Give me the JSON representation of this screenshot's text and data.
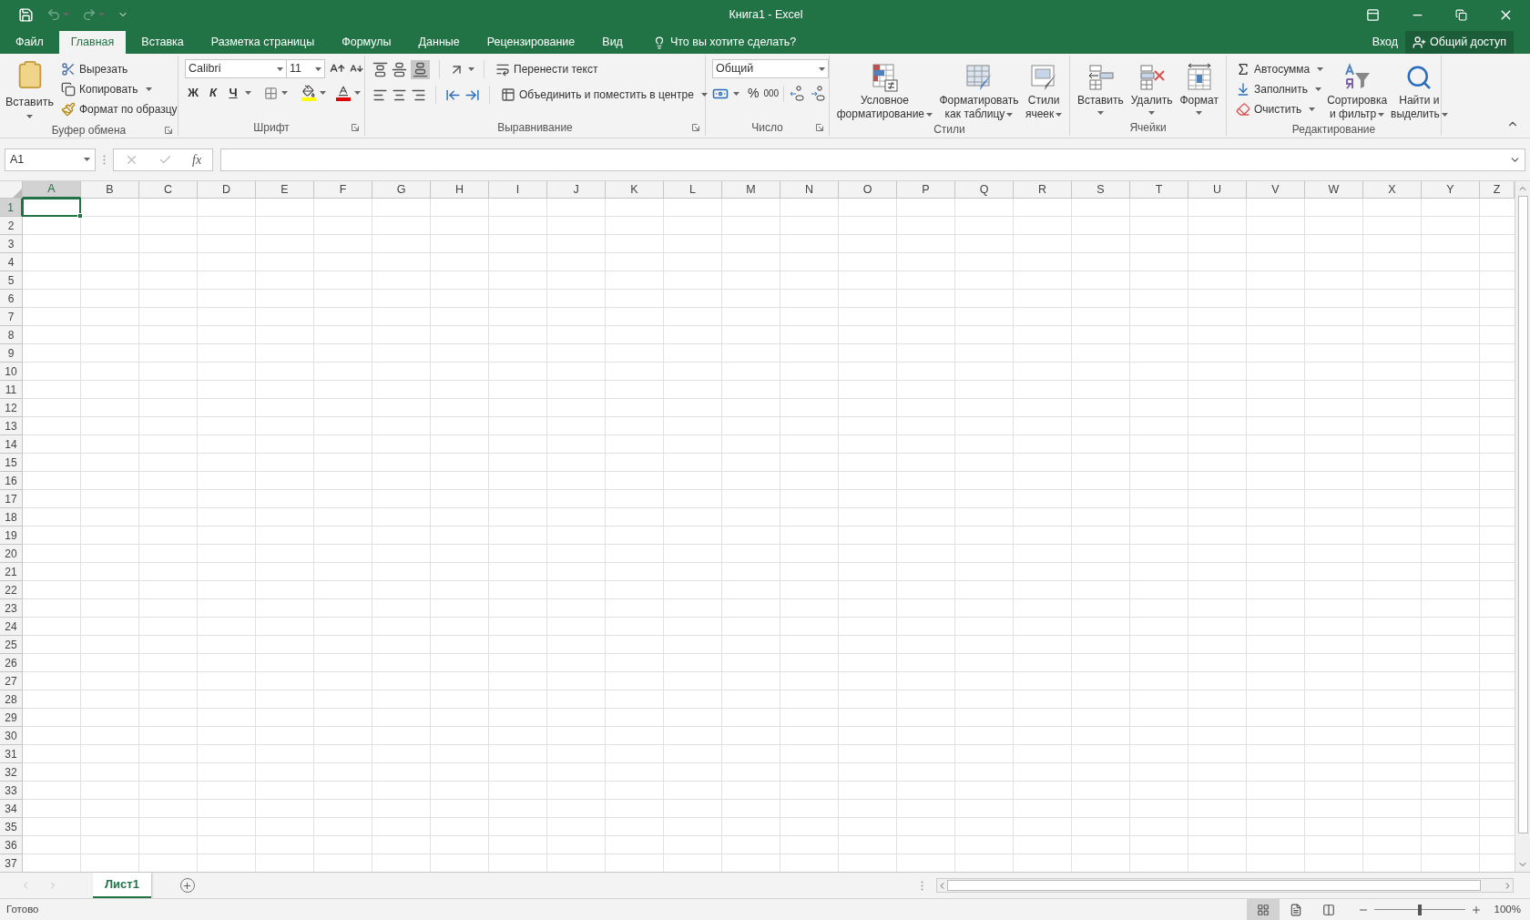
{
  "title_bar": {
    "title": "Книга1 - Excel"
  },
  "tabs": [
    {
      "label": "Файл",
      "selected": false
    },
    {
      "label": "Главная",
      "selected": true
    },
    {
      "label": "Вставка",
      "selected": false
    },
    {
      "label": "Разметка страницы",
      "selected": false
    },
    {
      "label": "Формулы",
      "selected": false
    },
    {
      "label": "Данные",
      "selected": false
    },
    {
      "label": "Рецензирование",
      "selected": false
    },
    {
      "label": "Вид",
      "selected": false
    }
  ],
  "tell_me": "Что вы хотите сделать?",
  "sign_in": "Вход",
  "share": "Общий доступ",
  "ribbon": {
    "groups": [
      {
        "kind": "clipboard",
        "name": "Буфер обмена",
        "paste": "Вставить",
        "items": [
          "Вырезать",
          "Копировать",
          "Формат по образцу"
        ]
      },
      {
        "kind": "font",
        "name": "Шрифт",
        "font_name": "Calibri",
        "font_size": "11",
        "styles": [
          "Ж",
          "К",
          "Ч"
        ]
      },
      {
        "kind": "alignment",
        "name": "Выравнивание",
        "wrap": "Перенести текст",
        "merge": "Объединить и поместить в центре"
      },
      {
        "kind": "number",
        "name": "Число",
        "format": "Общий",
        "percent": "%",
        "thousands": "000"
      },
      {
        "kind": "styles",
        "name": "Стили",
        "buttons": [
          {
            "lines": [
              "Условное",
              "форматирование"
            ]
          },
          {
            "lines": [
              "Форматировать",
              "как таблицу"
            ]
          },
          {
            "lines": [
              "Стили",
              "ячеек"
            ]
          }
        ]
      },
      {
        "kind": "cells",
        "name": "Ячейки",
        "buttons": [
          "Вставить",
          "Удалить",
          "Формат"
        ]
      },
      {
        "kind": "editing",
        "name": "Редактирование",
        "items": [
          "Автосумма",
          "Заполнить",
          "Очистить"
        ],
        "buttons": [
          {
            "lines": [
              "Сортировка",
              "и фильтр"
            ]
          },
          {
            "lines": [
              "Найти и",
              "выделить"
            ]
          }
        ]
      }
    ]
  },
  "formula_bar": {
    "name_box": "A1",
    "fx": "fx"
  },
  "columns": [
    {
      "label": "A",
      "selected": true
    },
    {
      "label": "B",
      "selected": false
    },
    {
      "label": "C",
      "selected": false
    },
    {
      "label": "D",
      "selected": false
    },
    {
      "label": "E",
      "selected": false
    },
    {
      "label": "F",
      "selected": false
    },
    {
      "label": "G",
      "selected": false
    },
    {
      "label": "H",
      "selected": false
    },
    {
      "label": "I",
      "selected": false
    },
    {
      "label": "J",
      "selected": false
    },
    {
      "label": "K",
      "selected": false
    },
    {
      "label": "L",
      "selected": false
    },
    {
      "label": "M",
      "selected": false
    },
    {
      "label": "N",
      "selected": false
    },
    {
      "label": "O",
      "selected": false
    },
    {
      "label": "P",
      "selected": false
    },
    {
      "label": "Q",
      "selected": false
    },
    {
      "label": "R",
      "selected": false
    },
    {
      "label": "S",
      "selected": false
    },
    {
      "label": "T",
      "selected": false
    },
    {
      "label": "U",
      "selected": false
    },
    {
      "label": "V",
      "selected": false
    },
    {
      "label": "W",
      "selected": false
    },
    {
      "label": "X",
      "selected": false
    },
    {
      "label": "Y",
      "selected": false
    },
    {
      "label": "Z",
      "selected": false
    }
  ],
  "rows": [
    {
      "label": "1",
      "selected": true
    },
    {
      "label": "2",
      "selected": false
    },
    {
      "label": "3",
      "selected": false
    },
    {
      "label": "4",
      "selected": false
    },
    {
      "label": "5",
      "selected": false
    },
    {
      "label": "6",
      "selected": false
    },
    {
      "label": "7",
      "selected": false
    },
    {
      "label": "8",
      "selected": false
    },
    {
      "label": "9",
      "selected": false
    },
    {
      "label": "10",
      "selected": false
    },
    {
      "label": "11",
      "selected": false
    },
    {
      "label": "12",
      "selected": false
    },
    {
      "label": "13",
      "selected": false
    },
    {
      "label": "14",
      "selected": false
    },
    {
      "label": "15",
      "selected": false
    },
    {
      "label": "16",
      "selected": false
    },
    {
      "label": "17",
      "selected": false
    },
    {
      "label": "18",
      "selected": false
    },
    {
      "label": "19",
      "selected": false
    },
    {
      "label": "20",
      "selected": false
    },
    {
      "label": "21",
      "selected": false
    },
    {
      "label": "22",
      "selected": false
    },
    {
      "label": "23",
      "selected": false
    },
    {
      "label": "24",
      "selected": false
    },
    {
      "label": "25",
      "selected": false
    },
    {
      "label": "26",
      "selected": false
    },
    {
      "label": "27",
      "selected": false
    },
    {
      "label": "28",
      "selected": false
    },
    {
      "label": "29",
      "selected": false
    },
    {
      "label": "30",
      "selected": false
    },
    {
      "label": "31",
      "selected": false
    },
    {
      "label": "32",
      "selected": false
    },
    {
      "label": "33",
      "selected": false
    },
    {
      "label": "34",
      "selected": false
    },
    {
      "label": "35",
      "selected": false
    },
    {
      "label": "36",
      "selected": false
    },
    {
      "label": "37",
      "selected": false
    }
  ],
  "sheets": [
    {
      "label": "Лист1",
      "selected": true
    }
  ],
  "status_bar": {
    "text": "Готово",
    "views": [
      {
        "selected": true
      },
      {
        "selected": false
      },
      {
        "selected": false
      }
    ],
    "zoom": {
      "level": 0.5
    },
    "zoom_text": "100%"
  }
}
